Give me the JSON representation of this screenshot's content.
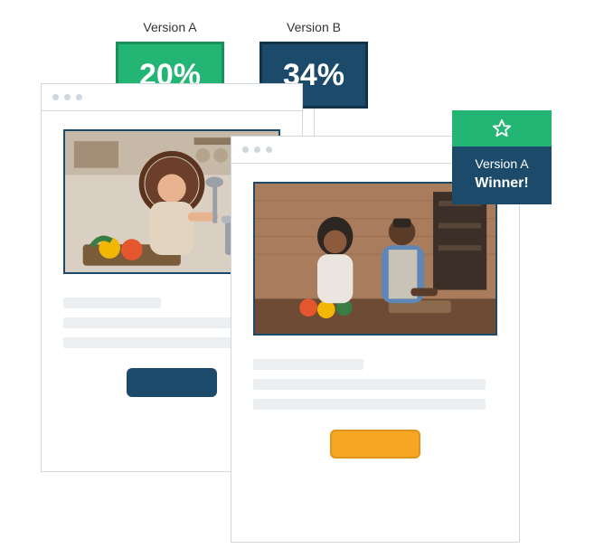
{
  "versions": {
    "a": {
      "label": "Version A",
      "percent": "20%"
    },
    "b": {
      "label": "Version B",
      "percent": "34%"
    }
  },
  "winner": {
    "line1": "Version A",
    "line2": "Winner!"
  },
  "colors": {
    "green": "#22b573",
    "navy": "#1b4a6b",
    "orange": "#f5a623",
    "skeleton": "#eceff1",
    "border": "#cfd8dc"
  }
}
